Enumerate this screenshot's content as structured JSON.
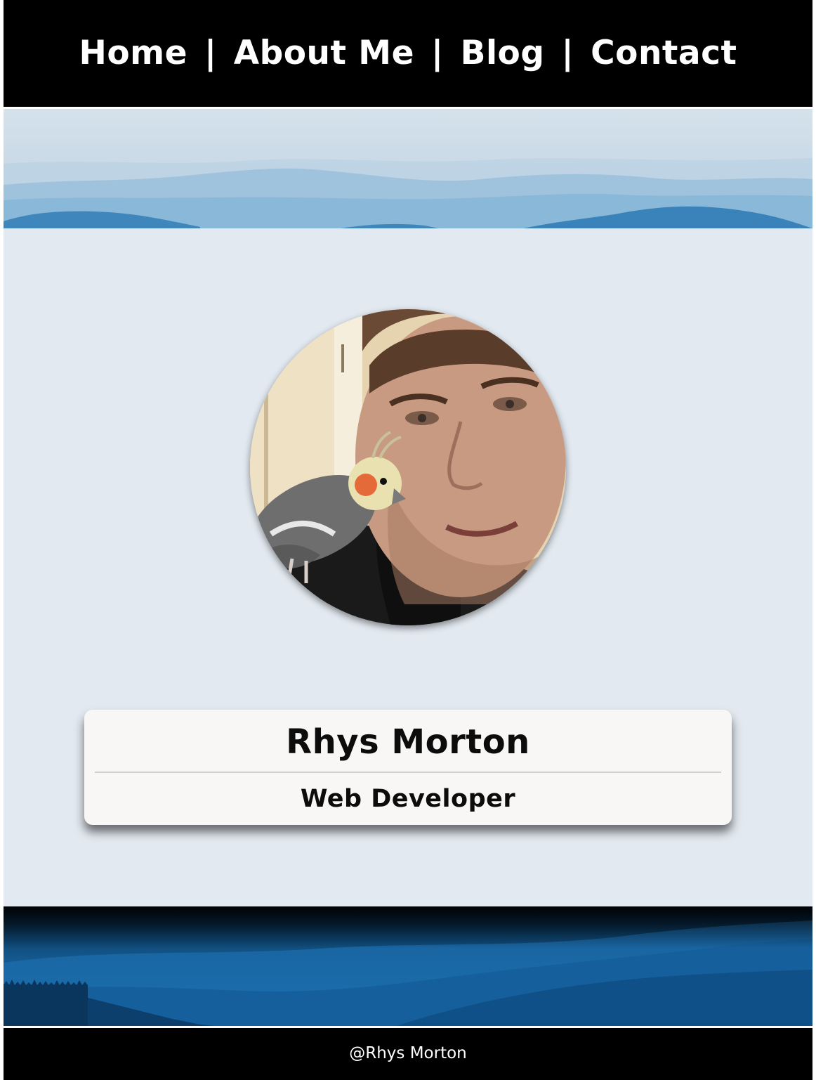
{
  "nav": {
    "items": [
      {
        "label": "Home"
      },
      {
        "label": "About Me"
      },
      {
        "label": "Blog"
      },
      {
        "label": "Contact"
      }
    ],
    "separator": "|"
  },
  "profile": {
    "name": "Rhys Morton",
    "role": "Web Developer",
    "photo_icon": "portrait-with-cockatiel-photo"
  },
  "footer": {
    "text": "@Rhys Morton"
  },
  "colors": {
    "nav_background": "#000000",
    "main_background": "#e2e9f0",
    "card_background": "#f8f7f5",
    "footer_background": "#000000",
    "text_light": "#ffffff",
    "text_dark": "#0c0c0c"
  }
}
